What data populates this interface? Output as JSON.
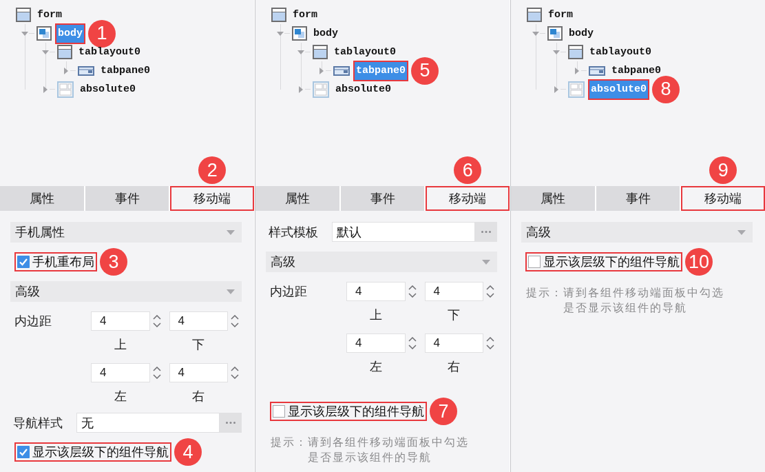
{
  "panels": [
    {
      "tree": [
        {
          "label": "form",
          "kind": "form",
          "selected": false,
          "highlighted": false,
          "children": [
            {
              "label": "body",
              "kind": "body",
              "expanded": true,
              "selected": true,
              "highlighted": true,
              "callout": "1",
              "children": [
                {
                  "label": "tablayout0",
                  "kind": "tablayout",
                  "expanded": true,
                  "selected": false,
                  "highlighted": false,
                  "children": [
                    {
                      "label": "tabpane0",
                      "kind": "tabpane",
                      "expanded": false,
                      "selected": false,
                      "highlighted": false
                    }
                  ]
                },
                {
                  "label": "absolute0",
                  "kind": "absolute",
                  "expanded": false,
                  "selected": false,
                  "highlighted": false
                }
              ]
            }
          ]
        }
      ],
      "tabs": [
        {
          "label": "属性",
          "selected": false,
          "highlighted": false
        },
        {
          "label": "事件",
          "selected": false,
          "highlighted": false
        },
        {
          "label": "移动端",
          "selected": true,
          "highlighted": true,
          "callout": "2"
        }
      ],
      "properties": [
        {
          "kind": "group",
          "label": "手机属性"
        },
        {
          "kind": "checkbox",
          "label": "手机重布局",
          "checked": true,
          "highlighted": true,
          "callout": "3"
        },
        {
          "kind": "group",
          "label": "高级"
        },
        {
          "kind": "padding",
          "label": "内边距",
          "fields": [
            {
              "value": "4",
              "caption": "上"
            },
            {
              "value": "4",
              "caption": "下"
            },
            {
              "value": "4",
              "caption": "左"
            },
            {
              "value": "4",
              "caption": "右"
            }
          ]
        },
        {
          "kind": "picker",
          "label": "导航样式",
          "value": "无"
        },
        {
          "kind": "checkbox",
          "label": "显示该层级下的组件导航",
          "checked": true,
          "highlighted": true,
          "callout": "4"
        }
      ]
    },
    {
      "tree": [
        {
          "label": "form",
          "kind": "form",
          "selected": false,
          "highlighted": false,
          "children": [
            {
              "label": "body",
              "kind": "body",
              "expanded": true,
              "selected": false,
              "highlighted": false,
              "children": [
                {
                  "label": "tablayout0",
                  "kind": "tablayout",
                  "expanded": true,
                  "selected": false,
                  "highlighted": false,
                  "children": [
                    {
                      "label": "tabpane0",
                      "kind": "tabpane",
                      "expanded": false,
                      "selected": true,
                      "highlighted": true,
                      "callout": "5"
                    }
                  ]
                },
                {
                  "label": "absolute0",
                  "kind": "absolute",
                  "expanded": false,
                  "selected": false,
                  "highlighted": false
                }
              ]
            }
          ]
        }
      ],
      "tabs": [
        {
          "label": "属性",
          "selected": false,
          "highlighted": false
        },
        {
          "label": "事件",
          "selected": false,
          "highlighted": false
        },
        {
          "label": "移动端",
          "selected": true,
          "highlighted": true,
          "callout": "6"
        }
      ],
      "properties": [
        {
          "kind": "picker",
          "label": "样式模板",
          "value": "默认"
        },
        {
          "kind": "group",
          "label": "高级"
        },
        {
          "kind": "padding",
          "label": "内边距",
          "fields": [
            {
              "value": "4",
              "caption": "上"
            },
            {
              "value": "4",
              "caption": "下"
            },
            {
              "value": "4",
              "caption": "左"
            },
            {
              "value": "4",
              "caption": "右"
            }
          ]
        },
        {
          "kind": "checkbox",
          "label": "显示该层级下的组件导航",
          "checked": false,
          "highlighted": true,
          "callout": "7"
        },
        {
          "kind": "hint",
          "text": "提示：请到各组件移动端面板中勾选是否显示该组件的导航"
        }
      ]
    },
    {
      "tree": [
        {
          "label": "form",
          "kind": "form",
          "selected": false,
          "highlighted": false,
          "children": [
            {
              "label": "body",
              "kind": "body",
              "expanded": true,
              "selected": false,
              "highlighted": false,
              "children": [
                {
                  "label": "tablayout0",
                  "kind": "tablayout",
                  "expanded": true,
                  "selected": false,
                  "highlighted": false,
                  "children": [
                    {
                      "label": "tabpane0",
                      "kind": "tabpane",
                      "expanded": false,
                      "selected": false,
                      "highlighted": false
                    }
                  ]
                },
                {
                  "label": "absolute0",
                  "kind": "absolute",
                  "expanded": false,
                  "selected": true,
                  "highlighted": true,
                  "callout": "8"
                }
              ]
            }
          ]
        }
      ],
      "tabs": [
        {
          "label": "属性",
          "selected": false,
          "highlighted": false
        },
        {
          "label": "事件",
          "selected": false,
          "highlighted": false
        },
        {
          "label": "移动端",
          "selected": true,
          "highlighted": true,
          "callout": "9"
        }
      ],
      "properties": [
        {
          "kind": "group",
          "label": "高级"
        },
        {
          "kind": "checkbox",
          "label": "显示该层级下的组件导航",
          "checked": false,
          "highlighted": true,
          "callout": "10"
        },
        {
          "kind": "hint",
          "text": "提示：请到各组件移动端面板中勾选是否显示该组件的导航"
        }
      ]
    }
  ]
}
